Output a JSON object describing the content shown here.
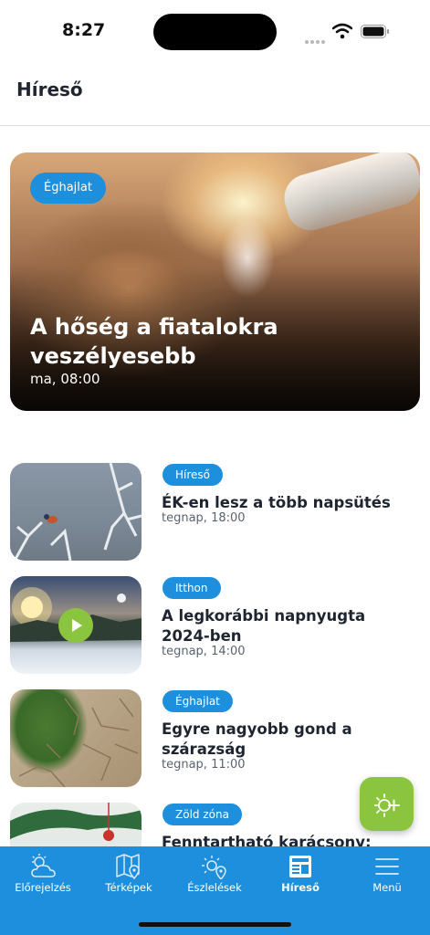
{
  "status_bar": {
    "time": "8:27",
    "icons": [
      "signal-dots-icon",
      "wifi-icon",
      "battery-icon"
    ]
  },
  "header": {
    "title": "Híreső"
  },
  "hero": {
    "tag": "Éghajlat",
    "title": "A hőség a fiatalokra veszélyesebb",
    "time": "ma, 08:00"
  },
  "news": [
    {
      "tag": "Híreső",
      "title": "ÉK-en lesz a több napsütés",
      "time": "tegnap, 18:00"
    },
    {
      "tag": "Itthon",
      "title": "A legkorábbi napnyugta 2024-ben",
      "time": "tegnap, 14:00",
      "has_video": true
    },
    {
      "tag": "Éghajlat",
      "title": "Egyre nagyobb gond a szárazság",
      "time": "tegnap, 11:00"
    },
    {
      "tag": "Zöld zóna",
      "title": "Fenntartható karácsony:",
      "time": ""
    }
  ],
  "fab": {
    "icon": "sun-plus-icon"
  },
  "tabs": [
    {
      "label": "Előrejelzés",
      "icon": "cloud-sun-icon"
    },
    {
      "label": "Térképek",
      "icon": "map-icon"
    },
    {
      "label": "Észlelések",
      "icon": "sun-location-icon"
    },
    {
      "label": "Híreső",
      "icon": "newspaper-icon",
      "active": true
    },
    {
      "label": "Menü",
      "icon": "menu-icon"
    }
  ],
  "colors": {
    "accent": "#1d8fdc",
    "fab": "#8bc43f",
    "text": "#1f2530",
    "muted": "#5b6370"
  }
}
